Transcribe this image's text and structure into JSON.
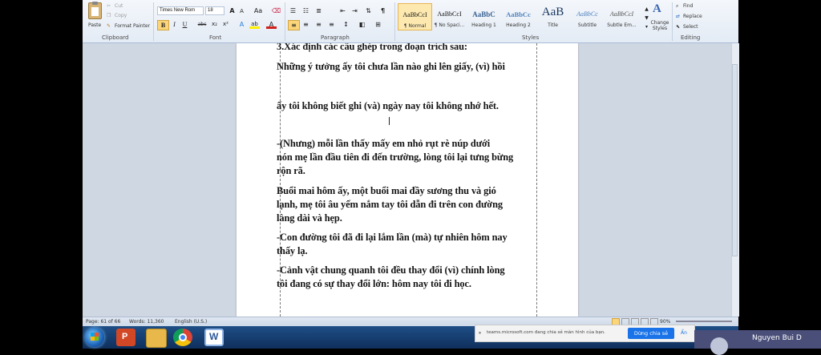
{
  "ribbon": {
    "clipboard": {
      "paste": "Paste",
      "cut": "Cut",
      "copy": "Copy",
      "format_painter": "Format Painter",
      "label": "Clipboard"
    },
    "font": {
      "name": "Times New Rom",
      "size": "18",
      "label": "Font",
      "grow": "A",
      "shrink": "A",
      "case": "Aa",
      "bold": "B",
      "italic": "I",
      "underline": "U",
      "strike": "abc",
      "sub": "x₂",
      "sup": "x²",
      "text_effects": "A",
      "highlight": "ab",
      "font_color": "A"
    },
    "paragraph": {
      "label": "Paragraph",
      "show_marks": "¶"
    },
    "styles": {
      "label": "Styles",
      "items": [
        {
          "preview": "AaBbCcI",
          "name": "¶ Normal"
        },
        {
          "preview": "AaBbCcI",
          "name": "¶ No Spaci..."
        },
        {
          "preview": "AaBbC",
          "name": "Heading 1"
        },
        {
          "preview": "AaBbCc",
          "name": "Heading 2"
        },
        {
          "preview": "AaB",
          "name": "Title"
        },
        {
          "preview": "AaBbCc",
          "name": "Subtitle"
        },
        {
          "preview": "AaBbCcI",
          "name": "Subtle Em..."
        }
      ],
      "change_styles": "Change Styles"
    },
    "editing": {
      "label": "Editing",
      "find": "Find",
      "replace": "Replace",
      "select": "Select"
    }
  },
  "document": {
    "lines": [
      "3.Xác định các câu ghép trong đoạn trích sau:",
      " Những ý tưởng ấy   tôi   chưa lần nào ghi lên giấy, (vì) hồi",
      "ấy  tôi  không biết ghi  (và)  ngày nay tôi không nhớ hết.",
      " -(Nhưng) mỗi lần   thấy   mấy em nhỏ   rụt rè núp dưới",
      "nón mẹ lần đầu tiên đi đến trường, lòng tôi   lại tưng bừng",
      "rộn rã.",
      " Buổi mai hôm ấy, một buổi mai đầy sương thu và gió",
      "lạnh, mẹ tôi   âu yếm nắm tay tôi dẫn đi trên con đường",
      "làng dài và hẹp.",
      "-Con đường tôi đã đi lại lắm lần (mà) tự nhiên hôm nay",
      "thấy lạ.",
      "-Cảnh vật chung quanh tôi    đều thay đổi (vì) chính lòng",
      "tôi đang có sự thay đổi lớn: hôm nay tôi đi học."
    ]
  },
  "status": {
    "page": "Page: 61 of 66",
    "words": "Words: 11,360",
    "language": "English (U.S.)",
    "zoom": "90%"
  },
  "share": {
    "text": "teams.microsoft.com đang chia sẻ màn hình của bạn.",
    "stop_button": "Dừng chia sẻ",
    "hide": "Ẩn"
  },
  "presenter": {
    "name": "Nguyen Bui D"
  },
  "colors": {
    "ribbon_bg": "#e3ebf5",
    "taskbar": "#1e4e86",
    "stop_button": "#1a73e8",
    "presenter_bg": "#4a4f7a"
  }
}
